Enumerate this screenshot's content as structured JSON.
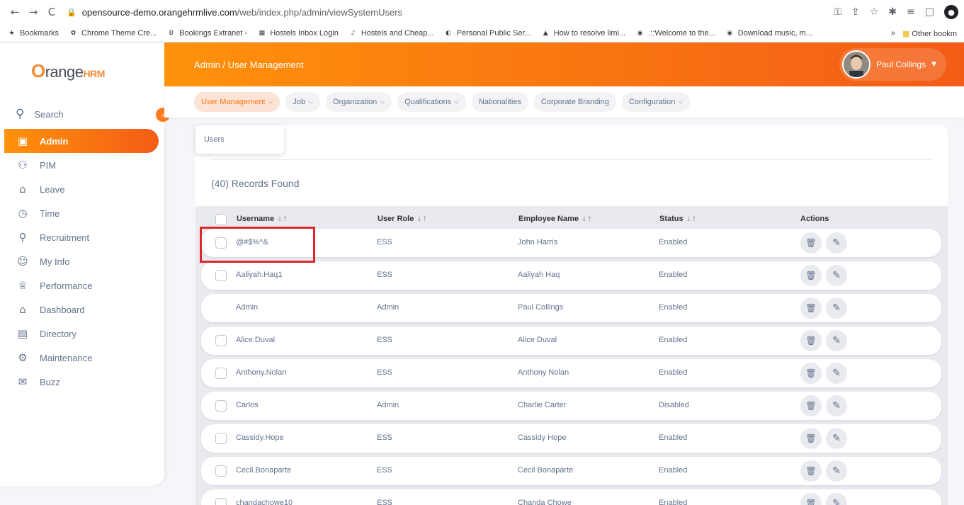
{
  "browser": {
    "back": "←",
    "forward": "→",
    "reload": "C",
    "url_host": "opensource-demo.orangehrmlive.com",
    "url_path": "/web/index.php/admin/viewSystemUsers",
    "bookmarks": [
      {
        "label": "Bookmarks",
        "icon": "★"
      },
      {
        "label": "Chrome Theme Cre...",
        "icon": "✿"
      },
      {
        "label": "Bookings Extranet -",
        "icon": "B"
      },
      {
        "label": "Hostels Inbox Login",
        "icon": "▦"
      },
      {
        "label": "Hostels and Cheap...",
        "icon": "♪"
      },
      {
        "label": "Personal Public Ser...",
        "icon": "◐"
      },
      {
        "label": "How to resolve limi...",
        "icon": "▲"
      },
      {
        "label": ".::Welcome to the...",
        "icon": "◉"
      },
      {
        "label": "Download music, m...",
        "icon": "◉"
      }
    ],
    "more": "»",
    "other_bookmarks": "Other bookm"
  },
  "brand": {
    "o": "O",
    "range": "range",
    "hrm": "HRM"
  },
  "sidebar": {
    "search": "Search",
    "items": [
      {
        "label": "Admin",
        "icon": "▣",
        "active": true
      },
      {
        "label": "PIM",
        "icon": "⚇"
      },
      {
        "label": "Leave",
        "icon": "⌂"
      },
      {
        "label": "Time",
        "icon": "◷"
      },
      {
        "label": "Recruitment",
        "icon": "⚲"
      },
      {
        "label": "My Info",
        "icon": "☺"
      },
      {
        "label": "Performance",
        "icon": "♕"
      },
      {
        "label": "Dashboard",
        "icon": "⌂"
      },
      {
        "label": "Directory",
        "icon": "▤"
      },
      {
        "label": "Maintenance",
        "icon": "⚙"
      },
      {
        "label": "Buzz",
        "icon": "✉"
      }
    ]
  },
  "topbar": {
    "title": "Admin / User Management",
    "user": "Paul Collings",
    "caret": "▼"
  },
  "tabs": [
    {
      "label": "User Management",
      "chev": true,
      "active": true
    },
    {
      "label": "Job",
      "chev": true
    },
    {
      "label": "Organization",
      "chev": true
    },
    {
      "label": "Qualifications",
      "chev": true
    },
    {
      "label": "Nationalities",
      "chev": false
    },
    {
      "label": "Corporate Branding",
      "chev": false
    },
    {
      "label": "Configuration",
      "chev": true
    }
  ],
  "dropdown": {
    "item": "Users"
  },
  "records": "(40) Records Found",
  "table": {
    "headers": {
      "username": "Username",
      "role": "User Role",
      "employee": "Employee Name",
      "status": "Status",
      "actions": "Actions"
    },
    "sort": "↓↑",
    "rows": [
      {
        "username": "@#$%^&",
        "role": "ESS",
        "employee": "John Harris",
        "status": "Enabled",
        "checkbox": true
      },
      {
        "username": "Aaliyah.Haq1",
        "role": "ESS",
        "employee": "Aaliyah Haq",
        "status": "Enabled",
        "checkbox": true
      },
      {
        "username": "Admin",
        "role": "Admin",
        "employee": "Paul Collings",
        "status": "Enabled",
        "checkbox": false
      },
      {
        "username": "Alice.Duval",
        "role": "ESS",
        "employee": "Alice Duval",
        "status": "Enabled",
        "checkbox": true
      },
      {
        "username": "Anthony.Nolan",
        "role": "ESS",
        "employee": "Anthony Nolan",
        "status": "Enabled",
        "checkbox": true
      },
      {
        "username": "Carlos",
        "role": "Admin",
        "employee": "Charlie Carter",
        "status": "Disabled",
        "checkbox": true
      },
      {
        "username": "Cassidy.Hope",
        "role": "ESS",
        "employee": "Cassidy Hope",
        "status": "Enabled",
        "checkbox": true
      },
      {
        "username": "Cecil.Bonaparte",
        "role": "ESS",
        "employee": "Cecil Bonaparte",
        "status": "Enabled",
        "checkbox": true
      },
      {
        "username": "chandachowe10",
        "role": "ESS",
        "employee": "Chanda Chowe",
        "status": "Enabled",
        "checkbox": true
      }
    ],
    "delete_icon": "🗑",
    "edit_icon": "✎"
  },
  "colors": {
    "accent": "#ff7b1d",
    "highlight": "#e0262d"
  }
}
